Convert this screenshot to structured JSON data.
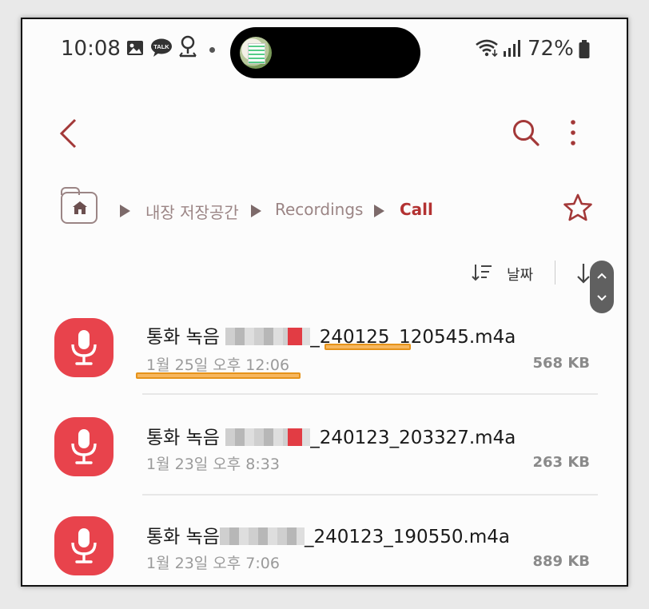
{
  "status_bar": {
    "time": "10:08",
    "notif_talk_label": "TALK",
    "battery": "72%",
    "icons": [
      "gallery-icon",
      "talk-icon",
      "location-icon",
      "wifi-icon",
      "signal-icon",
      "battery-icon"
    ]
  },
  "toolbar": {
    "back_icon": "back-chevron-icon",
    "search_icon": "search-icon",
    "more_icon": "more-vertical-icon"
  },
  "breadcrumb": {
    "home_icon": "home-folder-icon",
    "items": [
      "내장 저장공간",
      "Recordings",
      "Call"
    ]
  },
  "sort": {
    "label": "날짜",
    "icon": "sort-icon",
    "direction_icon": "sort-direction-arrow-icon"
  },
  "files": [
    {
      "name_prefix": "통화 녹음",
      "name_suffix": "_240125_120545.m4a",
      "date": "1월 25일 오후 12:06",
      "size": "568 KB"
    },
    {
      "name_prefix": "통화 녹음",
      "name_suffix": "_240123_203327.m4a",
      "date": "1월 23일 오후 8:33",
      "size": "263 KB"
    },
    {
      "name_prefix": "통화 녹음",
      "name_suffix": "_240123_190550.m4a",
      "date": "1월 23일 오후 7:06",
      "size": "889 KB"
    }
  ],
  "colors": {
    "accent": "#b33232",
    "icon_red": "#e8434c",
    "highlight": "#f6b75f"
  }
}
